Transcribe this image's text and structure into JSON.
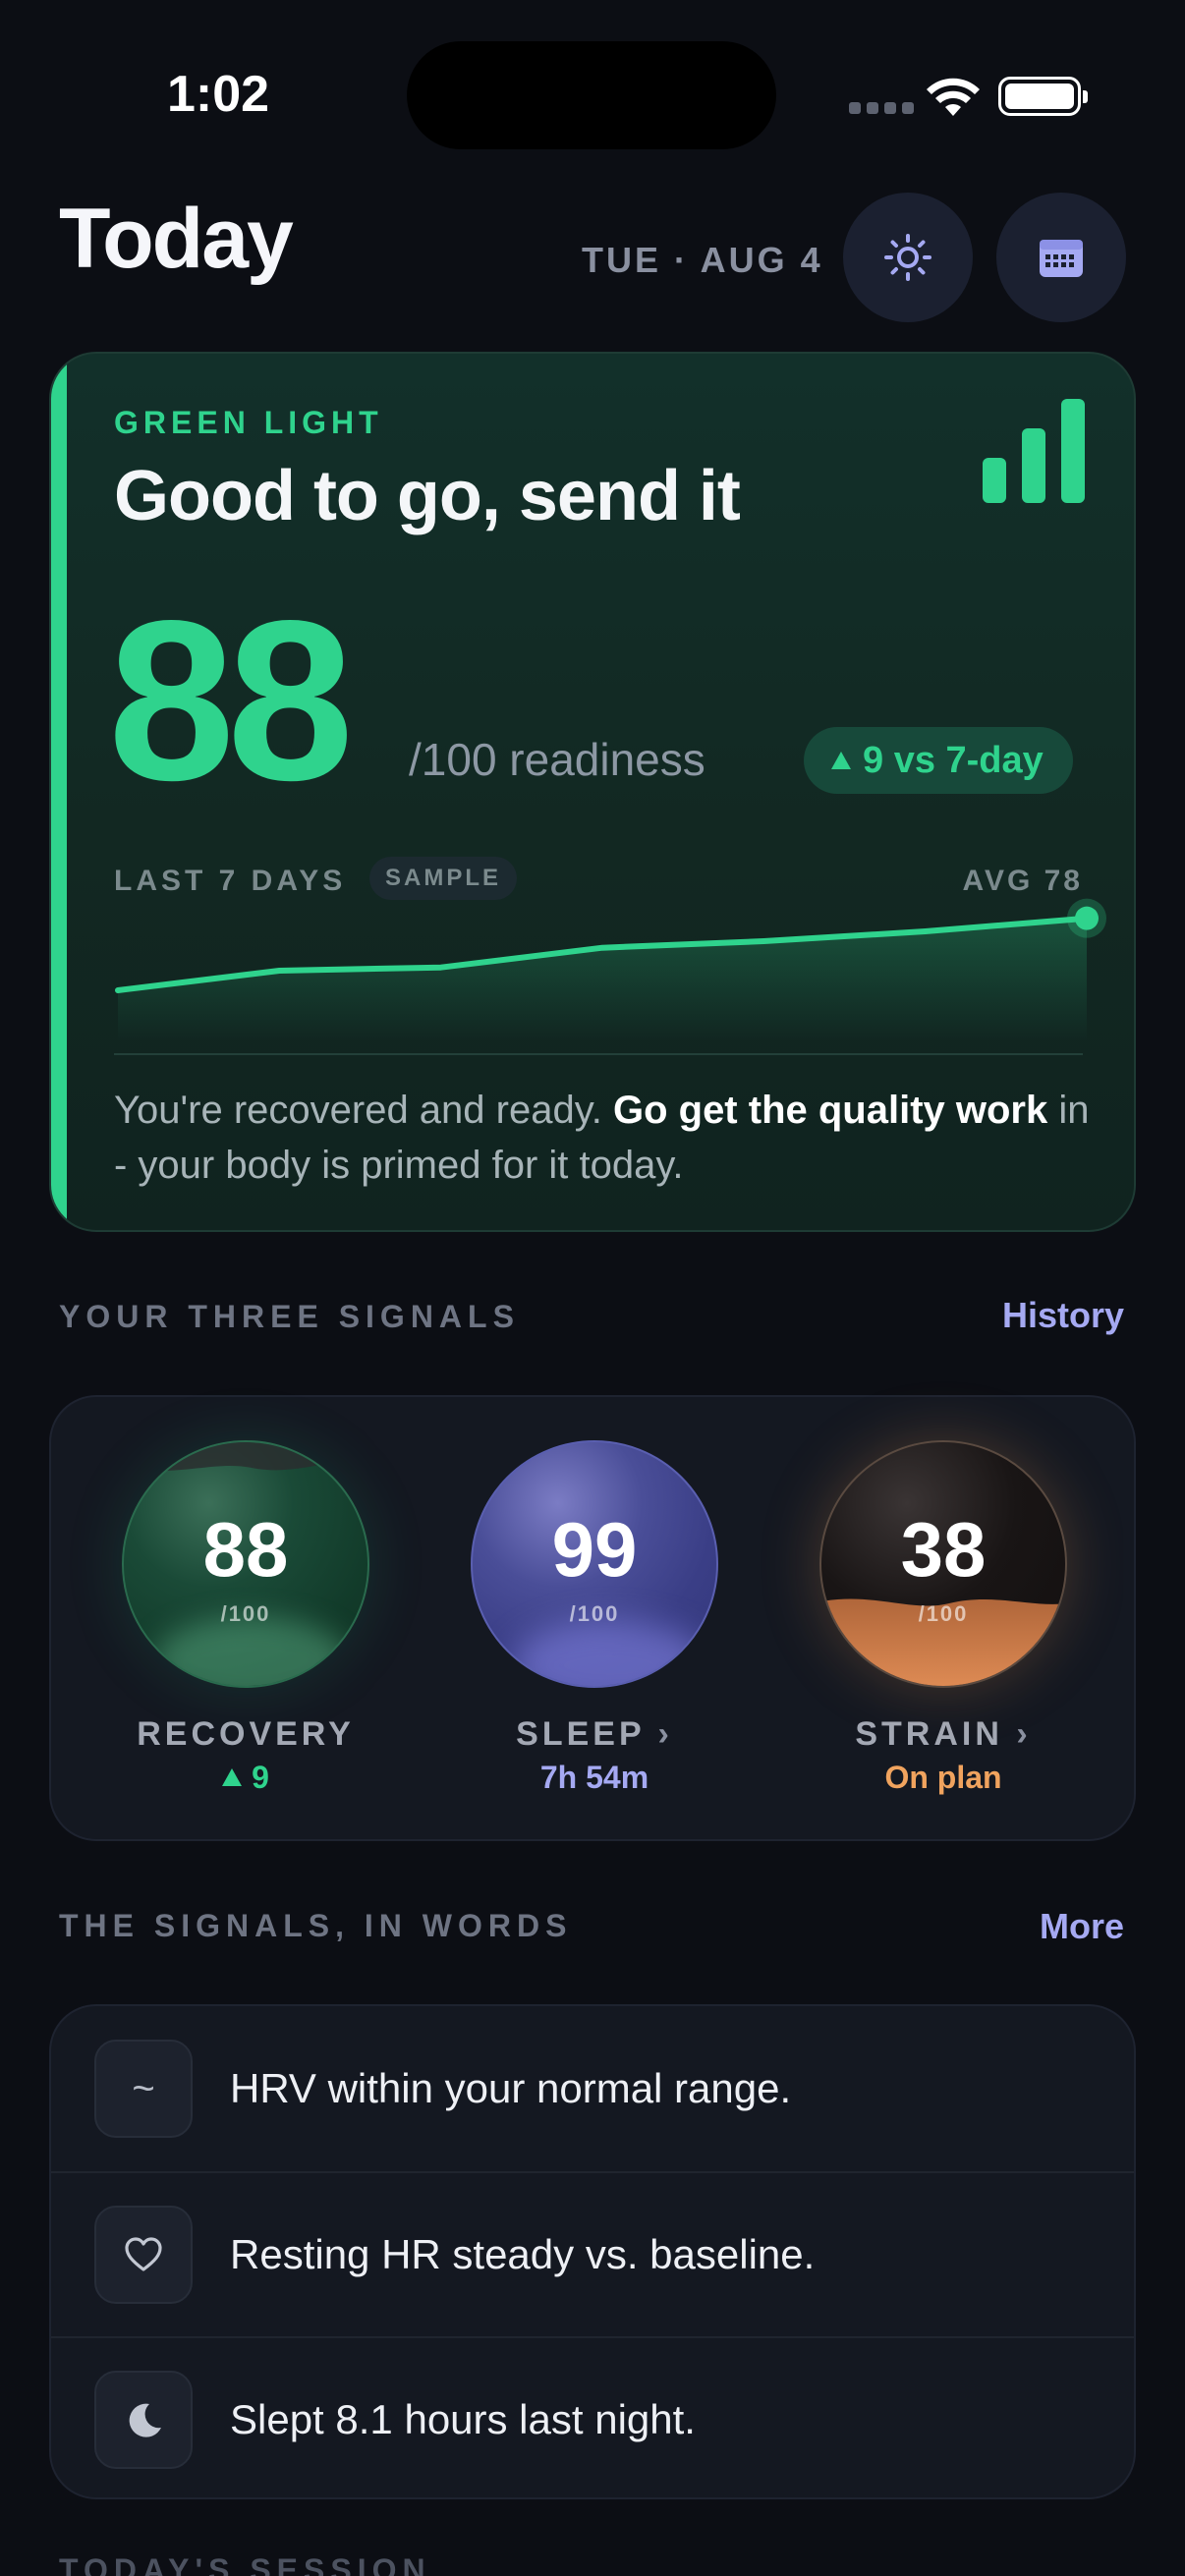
{
  "status_bar": {
    "time": "1:02"
  },
  "header": {
    "title": "Today",
    "date": "TUE · AUG 4"
  },
  "readiness": {
    "eyebrow": "GREEN LIGHT",
    "headline": "Good to go, send it",
    "score": "88",
    "score_suffix": "/100 readiness",
    "delta": "9 vs 7-day",
    "trend_label": "LAST 7 DAYS",
    "sample_tag": "SAMPLE",
    "avg_label": "AVG 78",
    "trend_values": [
      66,
      72,
      73,
      79,
      81,
      84,
      88
    ],
    "body_pre": "You're recovered and ready. ",
    "body_bold": "Go get the quality work",
    "body_post": " in - your body is primed for it today.",
    "accent_color": "#2fd38d"
  },
  "signals_section": {
    "title": "YOUR THREE SIGNALS",
    "link": "History"
  },
  "signals": [
    {
      "value": "88",
      "max": "/100",
      "label": "RECOVERY",
      "meta": "9",
      "color": "#2fd38d"
    },
    {
      "value": "99",
      "max": "/100",
      "label": "SLEEP",
      "chevron": "›",
      "meta": "7h 54m",
      "color": "#a5a9f2"
    },
    {
      "value": "38",
      "max": "/100",
      "label": "STRAIN",
      "chevron": "›",
      "meta": "On plan",
      "color": "#f0a35e"
    }
  ],
  "words_section": {
    "title": "THE SIGNALS, IN WORDS",
    "link": "More"
  },
  "words": [
    {
      "icon": "wave-icon",
      "glyph": "~",
      "text": "HRV within your normal range."
    },
    {
      "icon": "heart-icon",
      "text": "Resting HR steady vs. baseline."
    },
    {
      "icon": "moon-icon",
      "text": "Slept 8.1 hours last night."
    }
  ],
  "next_section": {
    "title": "TODAY'S SESSION"
  }
}
